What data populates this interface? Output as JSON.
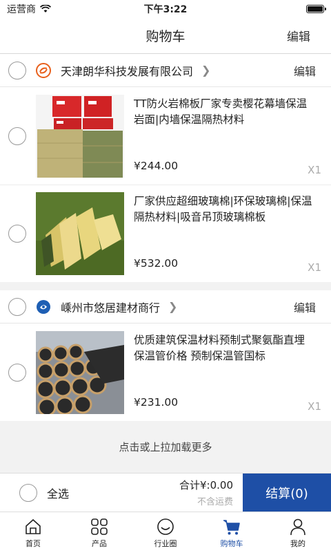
{
  "status_bar": {
    "carrier": "运营商",
    "time": "下午3:22"
  },
  "nav": {
    "title": "购物车",
    "edit_label": "编辑"
  },
  "shops": [
    {
      "name": "天津朗华科技发展有限公司",
      "edit_label": "编辑",
      "logo_icon": "orange-swirl-logo",
      "items": [
        {
          "title": "TT防火岩棉板厂家专卖樱花幕墙保温岩面|内墙保温隔热材料",
          "price": "¥244.00",
          "qty": "X1"
        },
        {
          "title": "厂家供应超细玻璃棉|环保玻璃棉|保温隔热材料|吸音吊顶玻璃棉板",
          "price": "¥532.00",
          "qty": "X1"
        }
      ]
    },
    {
      "name": "嵊州市悠居建材商行",
      "edit_label": "编辑",
      "logo_icon": "blue-circle-logo",
      "items": [
        {
          "title": "优质建筑保温材料预制式聚氨酯直埋保温管价格 预制保温管国标",
          "price": "¥231.00",
          "qty": "X1"
        }
      ]
    }
  ],
  "load_more": "点击或上拉加载更多",
  "checkout": {
    "select_all": "全选",
    "total": "合计¥:0.00",
    "shipping_note": "不含运费",
    "button": "结算(0)"
  },
  "tabs": [
    {
      "label": "首页",
      "icon": "home-icon"
    },
    {
      "label": "产品",
      "icon": "grid-icon"
    },
    {
      "label": "行业圈",
      "icon": "smiley-icon"
    },
    {
      "label": "购物车",
      "icon": "cart-icon",
      "active": true
    },
    {
      "label": "我的",
      "icon": "person-icon"
    }
  ],
  "colors": {
    "accent": "#1e4fa6",
    "shop_logo_1": "#e8601c",
    "shop_logo_2": "#1e5fb4"
  }
}
